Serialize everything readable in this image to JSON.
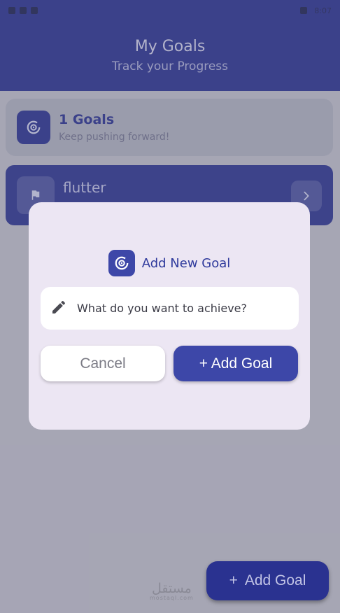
{
  "header": {
    "title": "My Goals",
    "subtitle": "Track your Progress"
  },
  "statusbar": {
    "time": "8:07"
  },
  "summary": {
    "title": "1 Goals",
    "subtitle": "Keep pushing forward!"
  },
  "goals": [
    {
      "title": "flutter"
    }
  ],
  "dialog": {
    "title": "Add New Goal",
    "input_placeholder": "What do you want to achieve?",
    "input_value": "",
    "cancel_label": "Cancel",
    "add_label": "+ Add Goal"
  },
  "fab": {
    "plus": "+",
    "label": "Add Goal"
  },
  "watermark": {
    "main": "مستقل",
    "sub": "mostaql.com"
  },
  "colors": {
    "primary": "#2a3290",
    "dialog_accent": "#3d47a8",
    "dialog_bg": "#ece6f3"
  }
}
